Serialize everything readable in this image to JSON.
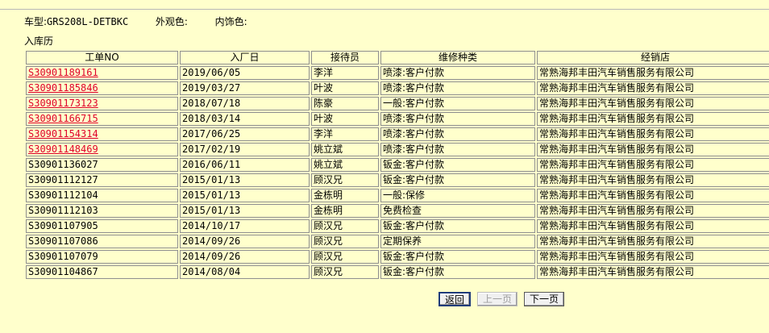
{
  "header": {
    "model_label": "车型:",
    "model_value": "GRS208L-DETBKC",
    "exterior_label": "外观色:",
    "exterior_value": "",
    "interior_label": "内饰色:",
    "interior_value": ""
  },
  "section_title": "入库历",
  "table": {
    "columns": [
      "工单NO",
      "入厂日",
      "接待员",
      "维修种类",
      "经销店"
    ],
    "rows": [
      {
        "no": "S30901189161",
        "date": "2019/06/05",
        "advisor": "李洋",
        "type": "喷漆:客户付款",
        "dealer": "常熟海邦丰田汽车销售服务有限公司",
        "link": true
      },
      {
        "no": "S30901185846",
        "date": "2019/03/27",
        "advisor": "叶波",
        "type": "喷漆:客户付款",
        "dealer": "常熟海邦丰田汽车销售服务有限公司",
        "link": true
      },
      {
        "no": "S30901173123",
        "date": "2018/07/18",
        "advisor": "陈豪",
        "type": "一般:客户付款",
        "dealer": "常熟海邦丰田汽车销售服务有限公司",
        "link": true
      },
      {
        "no": "S30901166715",
        "date": "2018/03/14",
        "advisor": "叶波",
        "type": "喷漆:客户付款",
        "dealer": "常熟海邦丰田汽车销售服务有限公司",
        "link": true
      },
      {
        "no": "S30901154314",
        "date": "2017/06/25",
        "advisor": "李洋",
        "type": "喷漆:客户付款",
        "dealer": "常熟海邦丰田汽车销售服务有限公司",
        "link": true
      },
      {
        "no": "S30901148469",
        "date": "2017/02/19",
        "advisor": "姚立斌",
        "type": "喷漆:客户付款",
        "dealer": "常熟海邦丰田汽车销售服务有限公司",
        "link": true
      },
      {
        "no": "S30901136027",
        "date": "2016/06/11",
        "advisor": "姚立斌",
        "type": "钣金:客户付款",
        "dealer": "常熟海邦丰田汽车销售服务有限公司",
        "link": false
      },
      {
        "no": "S30901112127",
        "date": "2015/01/13",
        "advisor": "顾汉兄",
        "type": "钣金:客户付款",
        "dealer": "常熟海邦丰田汽车销售服务有限公司",
        "link": false
      },
      {
        "no": "S30901112104",
        "date": "2015/01/13",
        "advisor": "金栋明",
        "type": "一般:保修",
        "dealer": "常熟海邦丰田汽车销售服务有限公司",
        "link": false
      },
      {
        "no": "S30901112103",
        "date": "2015/01/13",
        "advisor": "金栋明",
        "type": "免费检查",
        "dealer": "常熟海邦丰田汽车销售服务有限公司",
        "link": false
      },
      {
        "no": "S30901107905",
        "date": "2014/10/17",
        "advisor": "顾汉兄",
        "type": "钣金:客户付款",
        "dealer": "常熟海邦丰田汽车销售服务有限公司",
        "link": false
      },
      {
        "no": "S30901107086",
        "date": "2014/09/26",
        "advisor": "顾汉兄",
        "type": "定期保养",
        "dealer": "常熟海邦丰田汽车销售服务有限公司",
        "link": false
      },
      {
        "no": "S30901107079",
        "date": "2014/09/26",
        "advisor": "顾汉兄",
        "type": "钣金:客户付款",
        "dealer": "常熟海邦丰田汽车销售服务有限公司",
        "link": false
      },
      {
        "no": "S30901104867",
        "date": "2014/08/04",
        "advisor": "顾汉兄",
        "type": "钣金:客户付款",
        "dealer": "常熟海邦丰田汽车销售服务有限公司",
        "link": false
      }
    ]
  },
  "pager": {
    "back_label": "返回",
    "prev_label": "上一页",
    "next_label": "下一页"
  }
}
